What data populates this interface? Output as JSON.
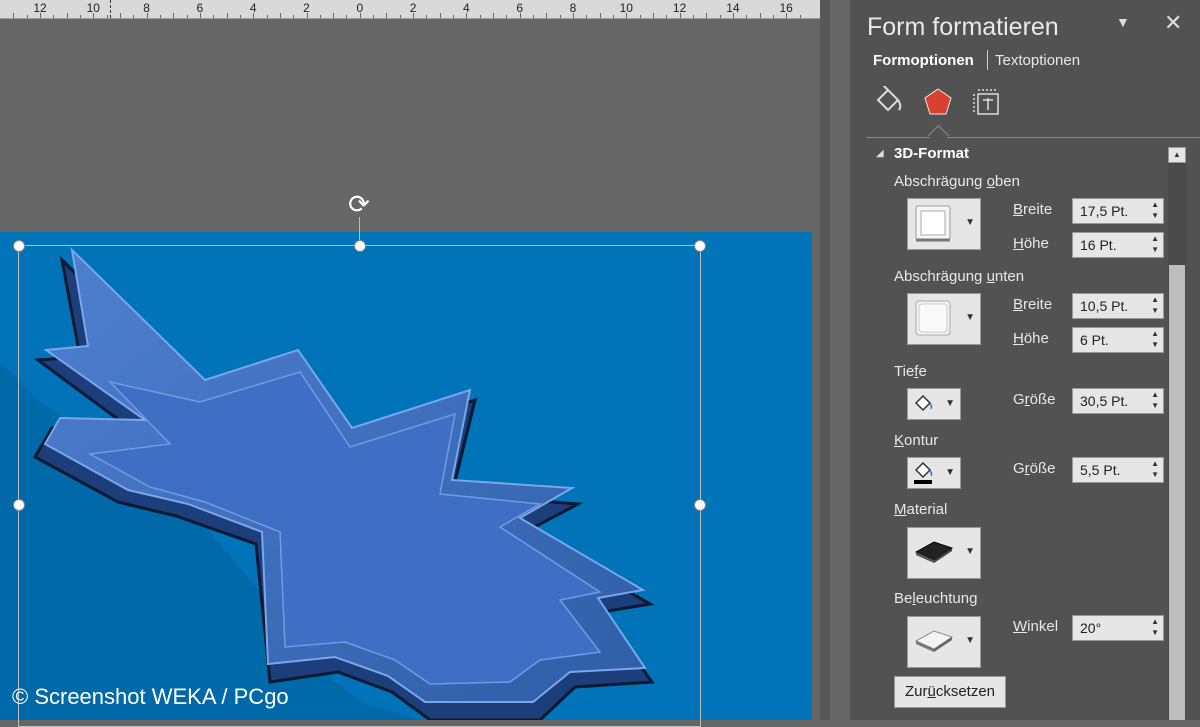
{
  "ruler": {
    "numbers": [
      "12",
      "10",
      "8",
      "6",
      "4",
      "2",
      "0",
      "2",
      "4",
      "6",
      "8",
      "10",
      "12",
      "14",
      "16"
    ]
  },
  "watermark": "© Screenshot WEKA / PCgo",
  "panel": {
    "title": "Form formatieren",
    "collapse_icon": "chevron-down-icon",
    "close_label": "✕",
    "tabs": {
      "form_options": "Formoptionen",
      "text_options": "Textoptionen"
    },
    "category_icons": [
      "fill-line-icon",
      "effects-pentagon-icon",
      "size-properties-icon"
    ],
    "section": {
      "title": "3D-Format",
      "bevel_top": {
        "label": "Abschrägung oben",
        "width_label": "Breite",
        "width_value": "17,5 Pt.",
        "height_label": "Höhe",
        "height_value": "16 Pt."
      },
      "bevel_bottom": {
        "label": "Abschrägung unten",
        "width_label": "Breite",
        "width_value": "10,5 Pt.",
        "height_label": "Höhe",
        "height_value": "6 Pt."
      },
      "depth": {
        "label": "Tiefe",
        "size_label": "Größe",
        "size_value": "30,5 Pt."
      },
      "contour": {
        "label": "Kontur",
        "size_label": "Größe",
        "size_value": "5,5 Pt."
      },
      "material": {
        "label": "Material"
      },
      "lighting": {
        "label": "Beleuchtung",
        "angle_label": "Winkel",
        "angle_value": "20°"
      },
      "reset_label": "Zurücksetzen"
    }
  },
  "colors": {
    "slide_bg": "#0173b8",
    "shape_fill": "#2f5fb3",
    "panel_bg": "#525252",
    "accent_red": "#d8412f"
  }
}
